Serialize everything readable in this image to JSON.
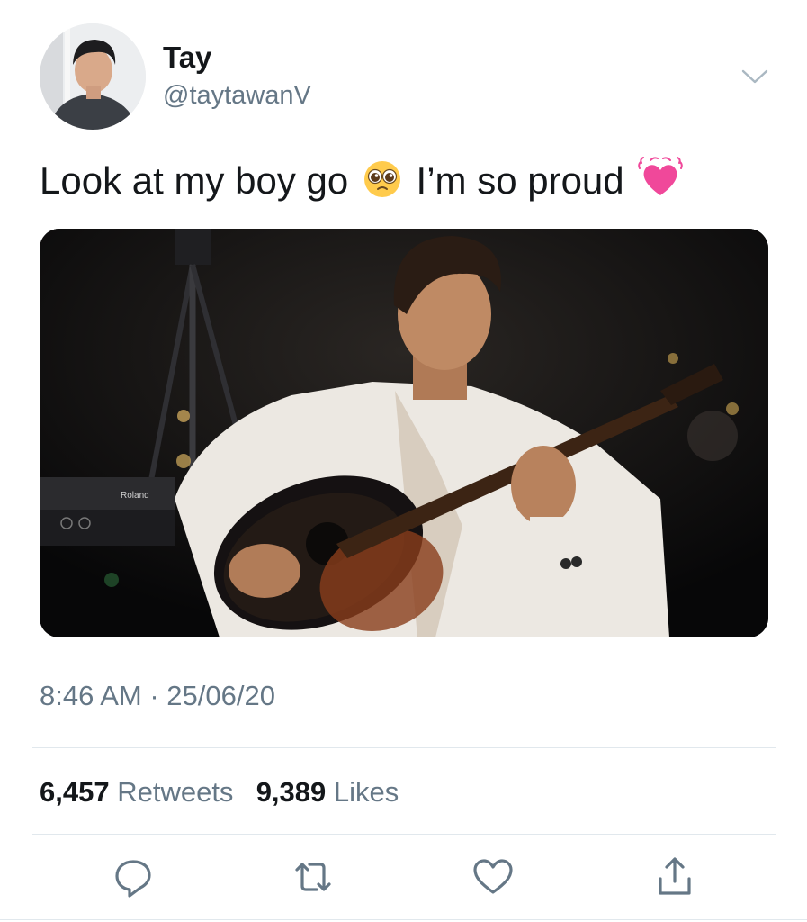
{
  "author": {
    "display_name": "Tay",
    "handle": "@taytawanV",
    "avatar_icon": "profile-photo"
  },
  "tweet": {
    "text_part1": "Look at my boy go",
    "emoji1": "pleading-face-emoji",
    "text_part2": "I’m so proud",
    "emoji2": "growing-heart-emoji",
    "media": {
      "kind": "photo",
      "subject": "young man playing acoustic guitar",
      "keyboard_label": "Roland"
    },
    "timestamp": "8:46 AM · 25/06/20"
  },
  "stats": {
    "retweets_count": "6,457",
    "retweets_label": "Retweets",
    "likes_count": "9,389",
    "likes_label": "Likes"
  },
  "actions": [
    {
      "name": "reply",
      "icon": "reply-icon"
    },
    {
      "name": "retweet",
      "icon": "retweet-icon"
    },
    {
      "name": "like",
      "icon": "heart-icon"
    },
    {
      "name": "share",
      "icon": "share-icon"
    }
  ],
  "colors": {
    "primary_text": "#14171a",
    "secondary_text": "#657786",
    "divider": "#e1e8ed",
    "heart_emoji": "#f0489a"
  }
}
